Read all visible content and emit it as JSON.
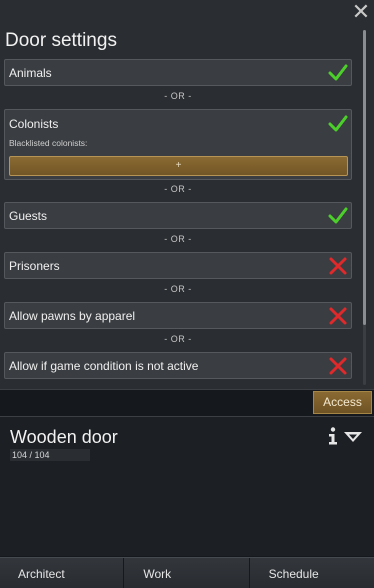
{
  "panel": {
    "title": "Door settings",
    "close_glyph": "✕",
    "or_label": "- OR -",
    "rows": [
      {
        "label": "Animals",
        "state": "allowed",
        "icon": "check-icon"
      },
      {
        "label": "Colonists",
        "state": "allowed",
        "icon": "check-icon",
        "sub_label": "Blacklisted colonists:",
        "add_label": "+"
      },
      {
        "label": "Guests",
        "state": "allowed",
        "icon": "check-icon"
      },
      {
        "label": "Prisoners",
        "state": "denied",
        "icon": "cross-icon"
      },
      {
        "label": "Allow pawns by apparel",
        "state": "denied",
        "icon": "cross-icon"
      },
      {
        "label": "Allow if game condition is not active",
        "state": "denied",
        "icon": "cross-icon"
      }
    ]
  },
  "access_tab": {
    "label": "Access"
  },
  "inspect": {
    "title": "Wooden door",
    "hit_points": "104 / 104",
    "hit_points_fraction": 1.0
  },
  "bottom_bar": {
    "architect": "Architect",
    "work": "Work",
    "schedule": "Schedule"
  },
  "colors": {
    "allowed": "#4ccf2a",
    "denied": "#e0292a",
    "accent_brown": "#8a6a33"
  }
}
